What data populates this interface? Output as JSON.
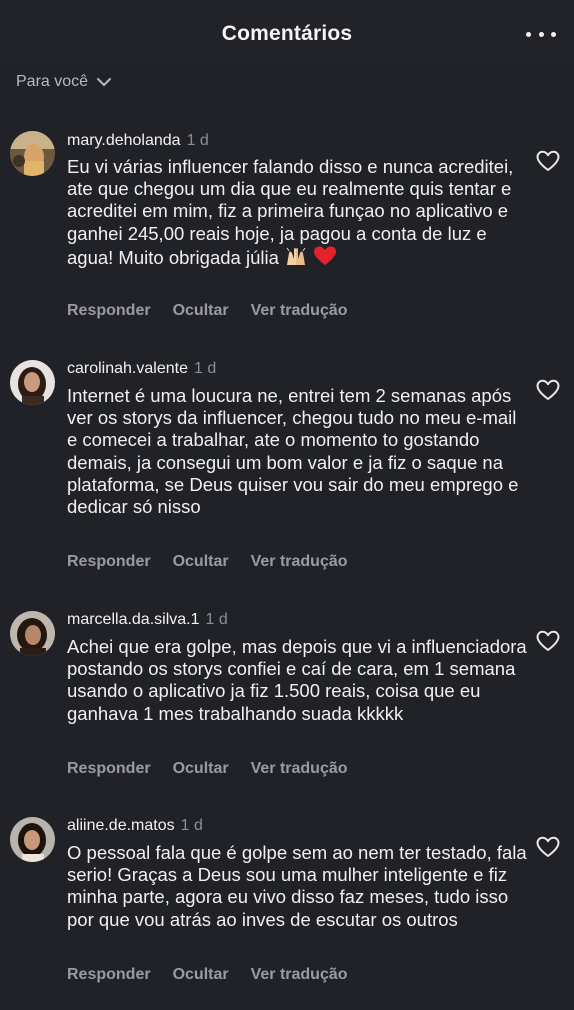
{
  "header": {
    "title": "Comentários",
    "more_icon": "more-horizontal-icon"
  },
  "filter": {
    "label": "Para você",
    "icon": "chevron-down-icon"
  },
  "actions": {
    "reply": "Responder",
    "hide": "Ocultar",
    "translate": "Ver tradução"
  },
  "comments": [
    {
      "username": "mary.deholanda",
      "time": "1 d",
      "text": "Eu vi várias influencer falando disso e nunca acreditei, ate que chegou um dia que eu realmente quis tentar e acreditei em mim, fiz a primeira funçao no aplicativo e ganhei 245,00 reais hoje, ja pagou a conta de luz e agua! Muito obrigada júlia",
      "emoji": [
        "raised-hands-emoji",
        "red-heart-emoji"
      ]
    },
    {
      "username": "carolinah.valente",
      "time": "1 d",
      "text": "Internet é uma loucura ne, entrei tem 2 semanas após ver os storys da influencer, chegou tudo no meu e-mail e comecei a trabalhar, ate o momento to gostando demais, ja consegui um bom valor e ja fiz o saque na plataforma, se Deus quiser vou sair do meu emprego e dedicar só nisso"
    },
    {
      "username": "marcella.da.silva.1",
      "time": "1 d",
      "text": "Achei que era golpe, mas depois que vi a influenciadora postando os storys confiei e caí de cara, em 1 semana usando o aplicativo ja fiz 1.500 reais, coisa que eu ganhava 1 mes trabalhando suada kkkkk"
    },
    {
      "username": "aliine.de.matos",
      "time": "1 d",
      "text": "O pessoal fala que é golpe sem ao nem ter testado, fala serio! Graças a Deus sou uma mulher inteligente e fiz minha parte, agora eu vivo disso faz meses, tudo isso por que vou atrás ao inves de escutar os outros"
    }
  ],
  "colors": {
    "background": "#212227",
    "text": "#f0f0f0",
    "muted": "#8d8e94",
    "heart": "#e8e8e8"
  }
}
